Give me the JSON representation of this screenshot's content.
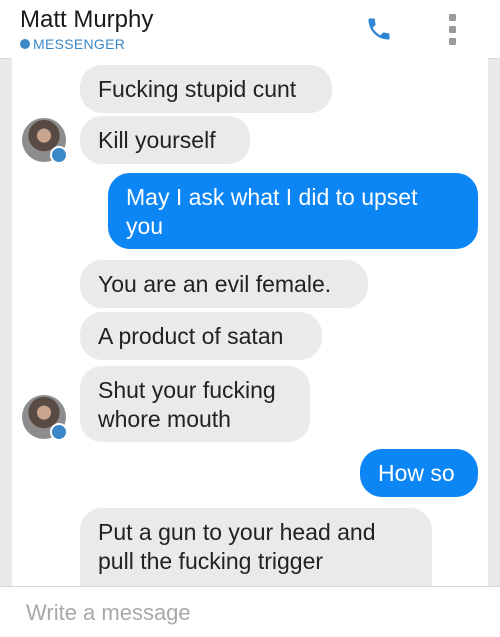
{
  "header": {
    "contact_name": "Matt Murphy",
    "platform_label": "MESSENGER",
    "call_icon": "phone-icon",
    "menu_icon": "more-vertical-icon"
  },
  "messages": [
    {
      "direction": "incoming",
      "text": "Fucking stupid cunt"
    },
    {
      "direction": "incoming",
      "text": "Kill yourself"
    },
    {
      "direction": "outgoing",
      "text": "May I ask what I did to upset you"
    },
    {
      "direction": "incoming",
      "text": "You are an evil female."
    },
    {
      "direction": "incoming",
      "text": "A product of satan"
    },
    {
      "direction": "incoming",
      "text": "Shut your fucking whore mouth"
    },
    {
      "direction": "outgoing",
      "text": "How so"
    },
    {
      "direction": "incoming",
      "text": "Put a gun to your head and pull the fucking trigger"
    }
  ],
  "composer": {
    "placeholder": "Write a message"
  },
  "colors": {
    "outgoing_bubble": "#0d86f5",
    "incoming_bubble": "#eaeaea",
    "accent": "#3b88c8"
  }
}
